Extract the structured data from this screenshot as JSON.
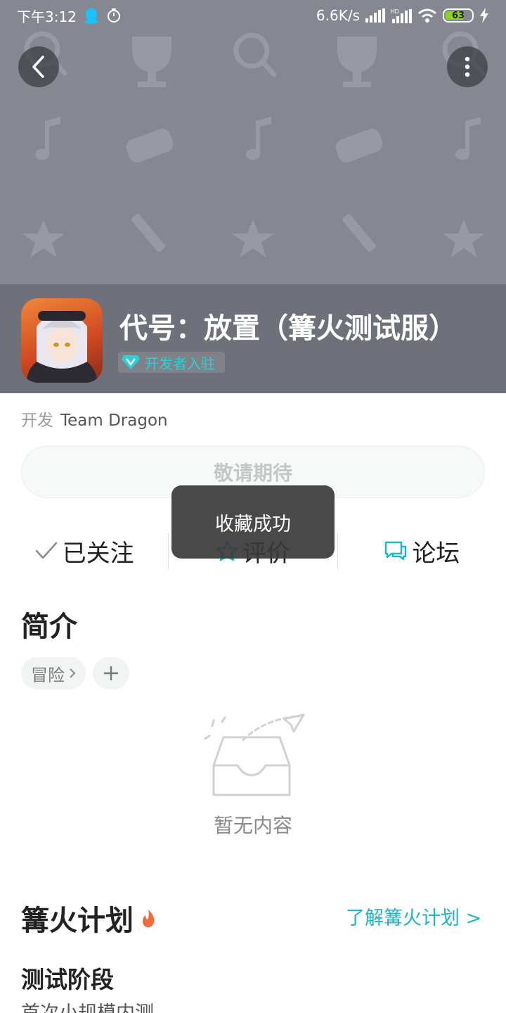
{
  "status_bar": {
    "time": "下午3:12",
    "network_speed": "6.6K/s",
    "battery_level": "63"
  },
  "app": {
    "title": "代号：放置（篝火测试服）",
    "dev_badge": "开发者入驻",
    "developer_label": "开发",
    "developer_name": "Team Dragon"
  },
  "main_button": {
    "label": "敬请期待"
  },
  "actions": {
    "follow_label": "已关注",
    "rate_label": "评价",
    "forum_label": "论坛"
  },
  "toast": {
    "text": "收藏成功"
  },
  "intro": {
    "title": "简介",
    "tags": [
      "冒险"
    ],
    "empty_text": "暂无内容"
  },
  "campfire": {
    "title": "篝火计划",
    "link_label": "了解篝火计划 >",
    "stage_title": "测试阶段",
    "stage_value": "首次小规模内测"
  },
  "colors": {
    "banner": "#858891",
    "info_strip": "#6e7179",
    "accent": "#1fb6c6"
  }
}
